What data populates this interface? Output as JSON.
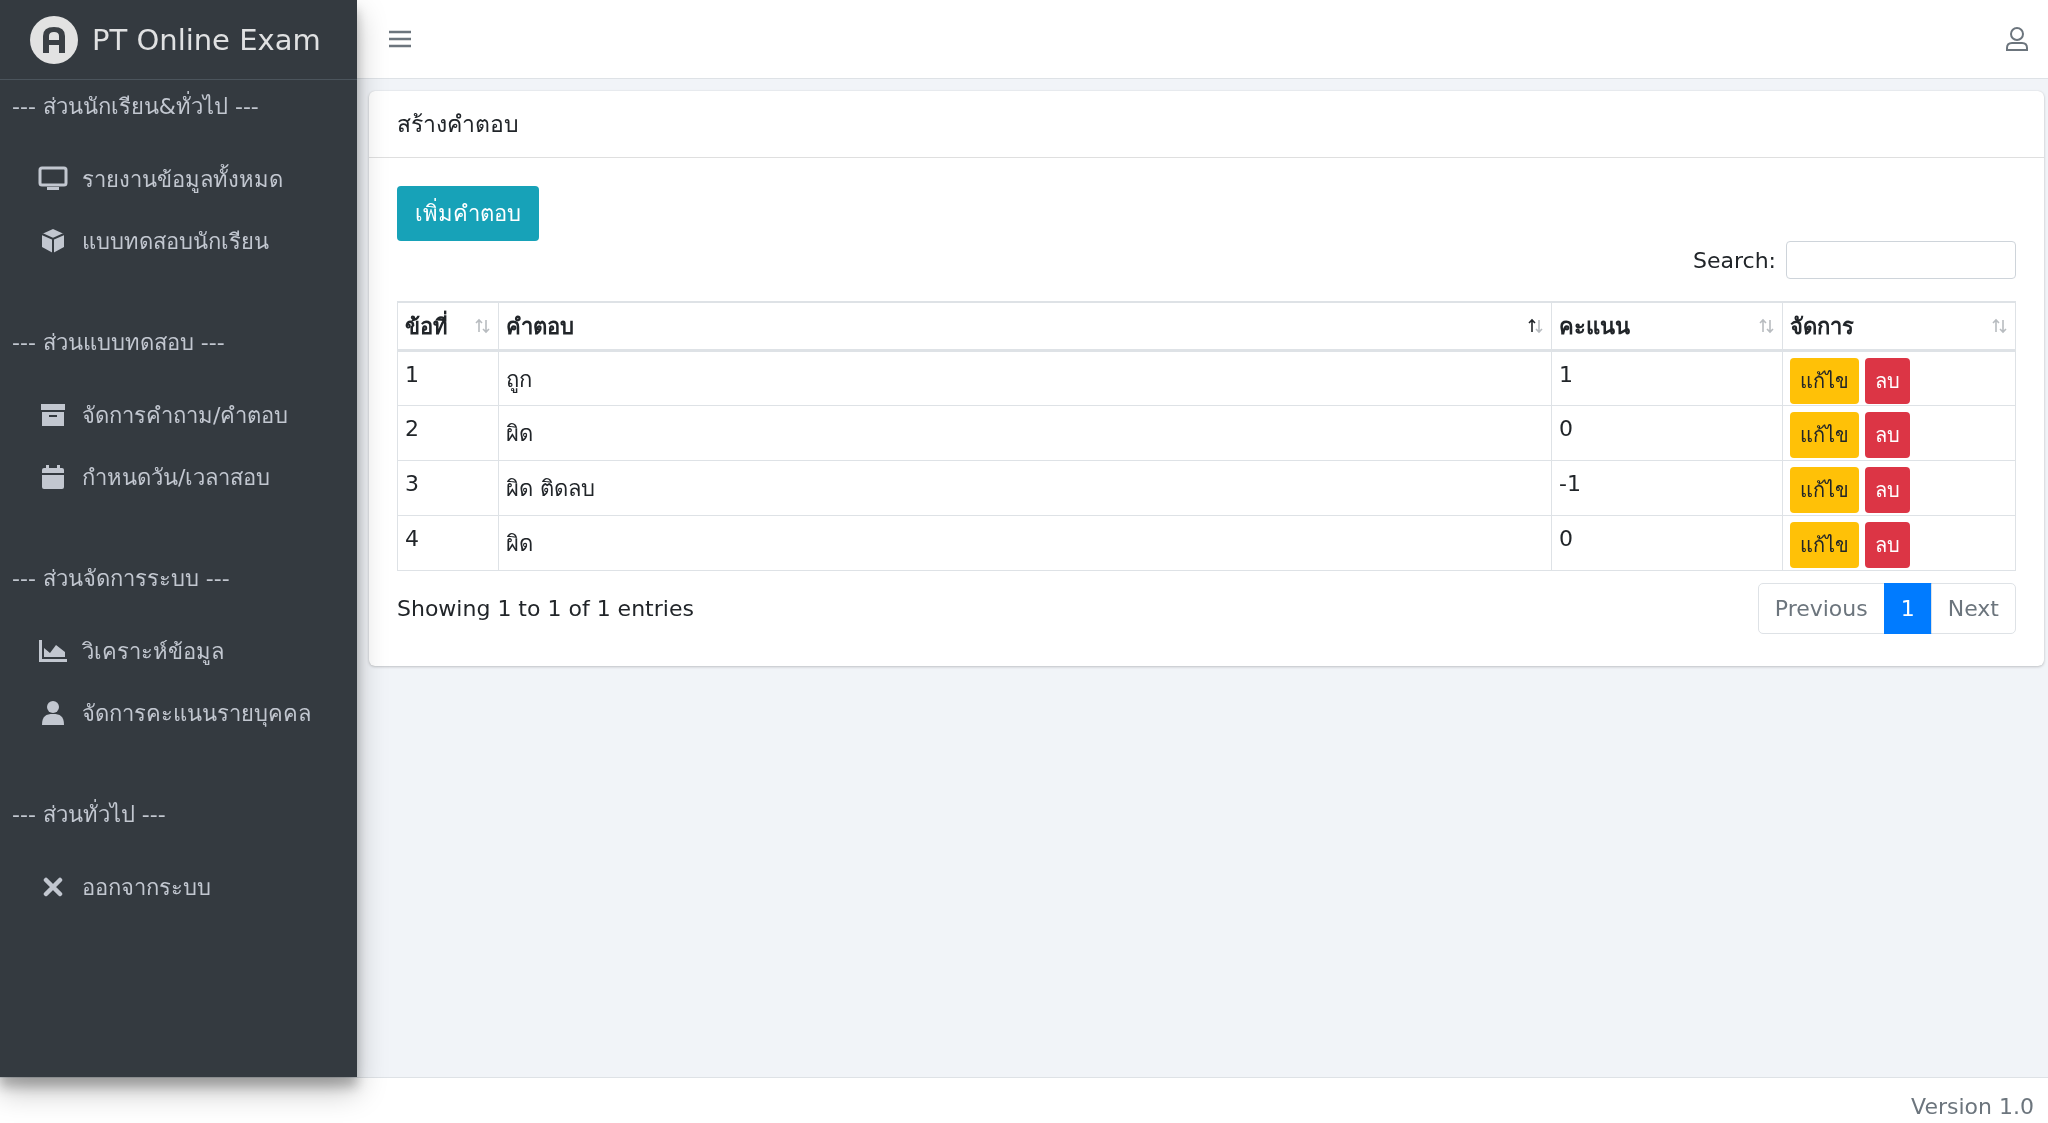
{
  "sidebar": {
    "brand": "PT Online Exam",
    "sections": [
      {
        "title": "--- ส่วนนักเรียน&ทั่วไป ---",
        "items": [
          {
            "label": "รายงานข้อมูลทั้งหมด",
            "kind": "monitor"
          },
          {
            "label": "แบบทดสอบนักเรียน",
            "kind": "cube"
          }
        ]
      },
      {
        "title": "--- ส่วนแบบทดสอบ ---",
        "items": [
          {
            "label": "จัดการคำถาม/คำตอบ",
            "kind": "archive"
          },
          {
            "label": "กำหนดวัน/เวลาสอบ",
            "kind": "calendar"
          }
        ]
      },
      {
        "title": "--- ส่วนจัดการระบบ ---",
        "items": [
          {
            "label": "วิเคราะห์ข้อมูล",
            "kind": "chart"
          },
          {
            "label": "จัดการคะแนนรายบุคคล",
            "kind": "user"
          }
        ]
      },
      {
        "title": "--- ส่วนทั่วไป ---",
        "items": [
          {
            "label": "ออกจากระบบ",
            "kind": "close"
          }
        ]
      }
    ]
  },
  "card": {
    "title": "สร้างคำตอบ",
    "add_button": "เพิ่มคำตอบ",
    "search_label": "Search:",
    "table": {
      "columns": [
        {
          "label": "ข้อที่",
          "sorted": false
        },
        {
          "label": "คำตอบ",
          "sorted": true
        },
        {
          "label": "คะแนน",
          "sorted": false
        },
        {
          "label": "จัดการ",
          "sorted": false
        }
      ],
      "rows": [
        {
          "no": "1",
          "answer": "ถูก",
          "score": "1",
          "edit": "แก้ไข",
          "delete": "ลบ"
        },
        {
          "no": "2",
          "answer": "ผิด",
          "score": "0",
          "edit": "แก้ไข",
          "delete": "ลบ"
        },
        {
          "no": "3",
          "answer": "ผิด ติดลบ",
          "score": "-1",
          "edit": "แก้ไข",
          "delete": "ลบ"
        },
        {
          "no": "4",
          "answer": "ผิด",
          "score": "0",
          "edit": "แก้ไข",
          "delete": "ลบ"
        }
      ]
    },
    "info": "Showing 1 to 1 of 1 entries",
    "pagination": {
      "previous": "Previous",
      "pages": [
        {
          "label": "1",
          "selected": true
        }
      ],
      "next": "Next"
    }
  },
  "footer": {
    "version": "Version 1.0"
  }
}
